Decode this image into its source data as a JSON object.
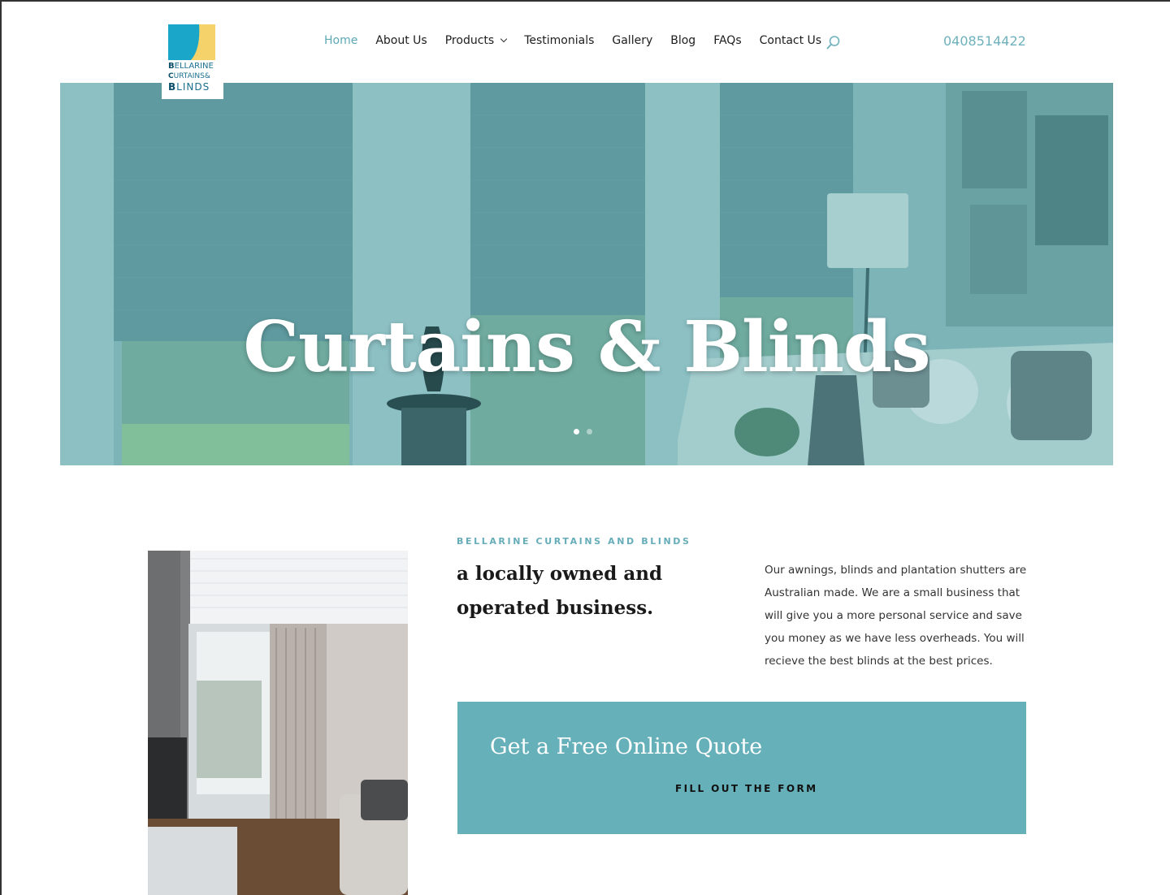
{
  "header": {
    "logo": {
      "line1_initial": "B",
      "line1_rest": "ELLARINE",
      "line2_initial": "C",
      "line2_rest": "URTAINS&",
      "line3_initial": "B",
      "line3_rest": "LINDS"
    },
    "nav": [
      {
        "label": "Home",
        "active": true
      },
      {
        "label": "About Us"
      },
      {
        "label": "Products",
        "has_dropdown": true
      },
      {
        "label": "Testimonials"
      },
      {
        "label": "Gallery"
      },
      {
        "label": "Blog"
      },
      {
        "label": "FAQs"
      },
      {
        "label": "Contact Us"
      }
    ],
    "phone": "0408514422"
  },
  "hero": {
    "title": "Curtains & Blinds",
    "slides_total": 2,
    "active_slide": 1
  },
  "about": {
    "eyebrow": "BELLARINE CURTAINS AND BLINDS",
    "heading": "a locally owned and operated business.",
    "paragraph": "Our awnings, blinds and plantation shutters are Australian made. We are a small business that will give you a more personal service and save you money as we have less overheads. You will recieve the best blinds at the best prices."
  },
  "quote": {
    "title": "Get a Free Online Quote",
    "button": "FILL OUT THE FORM"
  },
  "colors": {
    "accent": "#66b0ba",
    "nav_active": "#5da8b4",
    "hero_tint": "#7eb5b9",
    "white": "#ffffff"
  }
}
